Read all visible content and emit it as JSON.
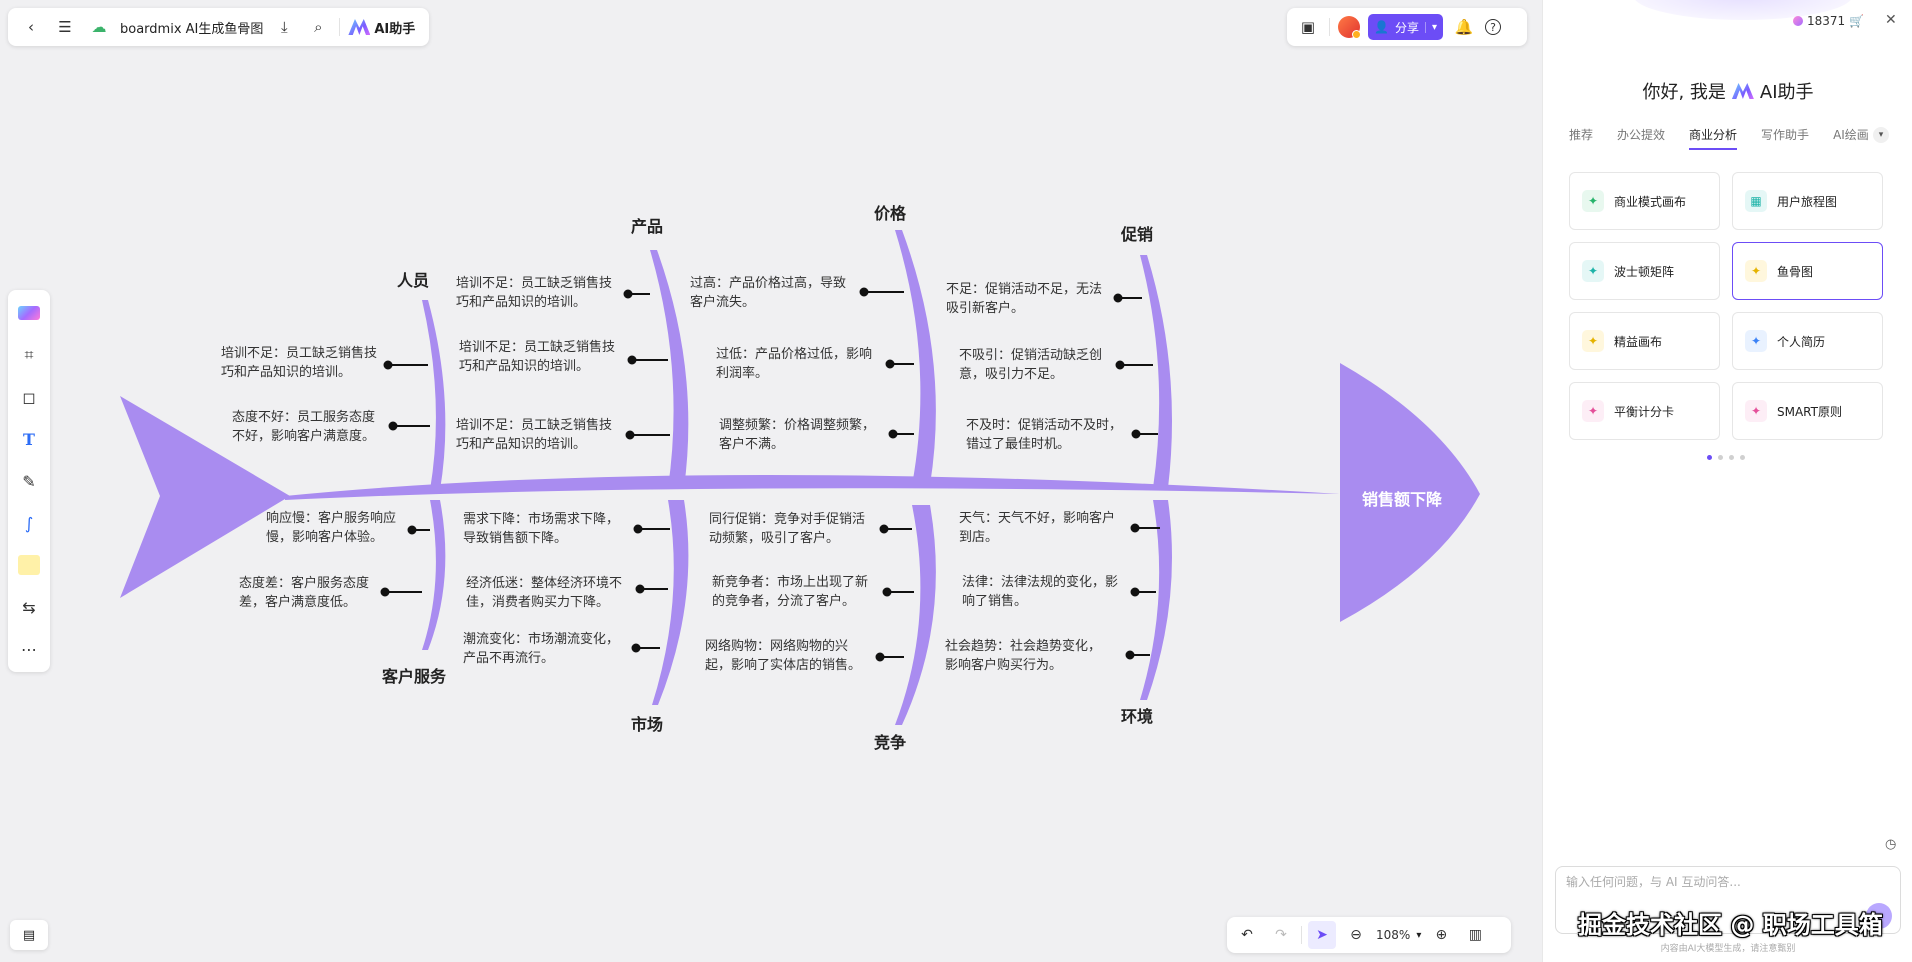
{
  "toolbar": {
    "doc_title": "boardmix AI生成鱼骨图",
    "ai_button": "AI助手",
    "share_label": "分享"
  },
  "diagram": {
    "head": "销售额下降",
    "top_categories": [
      "人员",
      "产品",
      "价格",
      "促销"
    ],
    "bottom_categories": [
      "客户服务",
      "市场",
      "竞争",
      "环境"
    ],
    "causes": {
      "renyuan": [
        "培训不足：员工缺乏销售技巧和产品知识的培训。",
        "态度不好：员工服务态度不好，影响客户满意度。"
      ],
      "chanpin": [
        "培训不足：员工缺乏销售技巧和产品知识的培训。",
        "培训不足：员工缺乏销售技巧和产品知识的培训。",
        "培训不足：员工缺乏销售技巧和产品知识的培训。"
      ],
      "jiage": [
        "过高：产品价格过高，导致客户流失。",
        "过低：产品价格过低，影响利润率。",
        "调整频繁：价格调整频繁，客户不满。"
      ],
      "cuxiao": [
        "不足：促销活动不足，无法吸引新客户。",
        "不吸引：促销活动缺乏创意，吸引力不足。",
        "不及时：促销活动不及时，错过了最佳时机。"
      ],
      "kehu": [
        "响应慢：客户服务响应慢，影响客户体验。",
        "态度差：客户服务态度差，客户满意度低。"
      ],
      "shichang": [
        "需求下降：市场需求下降，导致销售额下降。",
        "经济低迷：整体经济环境不佳，消费者购买力下降。",
        "潮流变化：市场潮流变化，产品不再流行。"
      ],
      "jingzheng": [
        "同行促销：竞争对手促销活动频繁，吸引了客户。",
        "新竞争者：市场上出现了新的竞争者，分流了客户。",
        "网络购物：网络购物的兴起，影响了实体店的销售。"
      ],
      "huanjing": [
        "天气：天气不好，影响客户到店。",
        "法律：法律法规的变化，影响了销售。",
        "社会趋势：社会趋势变化，影响客户购买行为。"
      ]
    }
  },
  "zoom": "108%",
  "panel": {
    "credits": "18371",
    "greeting": "你好, 我是",
    "assistant_name": "AI助手",
    "tabs": [
      "推荐",
      "办公提效",
      "商业分析",
      "写作助手",
      "AI绘画"
    ],
    "active_tab": "商业分析",
    "cards": [
      "商业模式画布",
      "用户旅程图",
      "波士顿矩阵",
      "鱼骨图",
      "精益画布",
      "个人简历",
      "平衡计分卡",
      "SMART原则"
    ],
    "input_placeholder": "输入任何问题，与 AI 互动问答...",
    "disclaimer": "内容由AI大模型生成，请注意甄别",
    "watermark": "掘金技术社区 @ 职场工具箱"
  },
  "colors": {
    "accent": "#6c4df6",
    "fish": "#a98cf0"
  }
}
